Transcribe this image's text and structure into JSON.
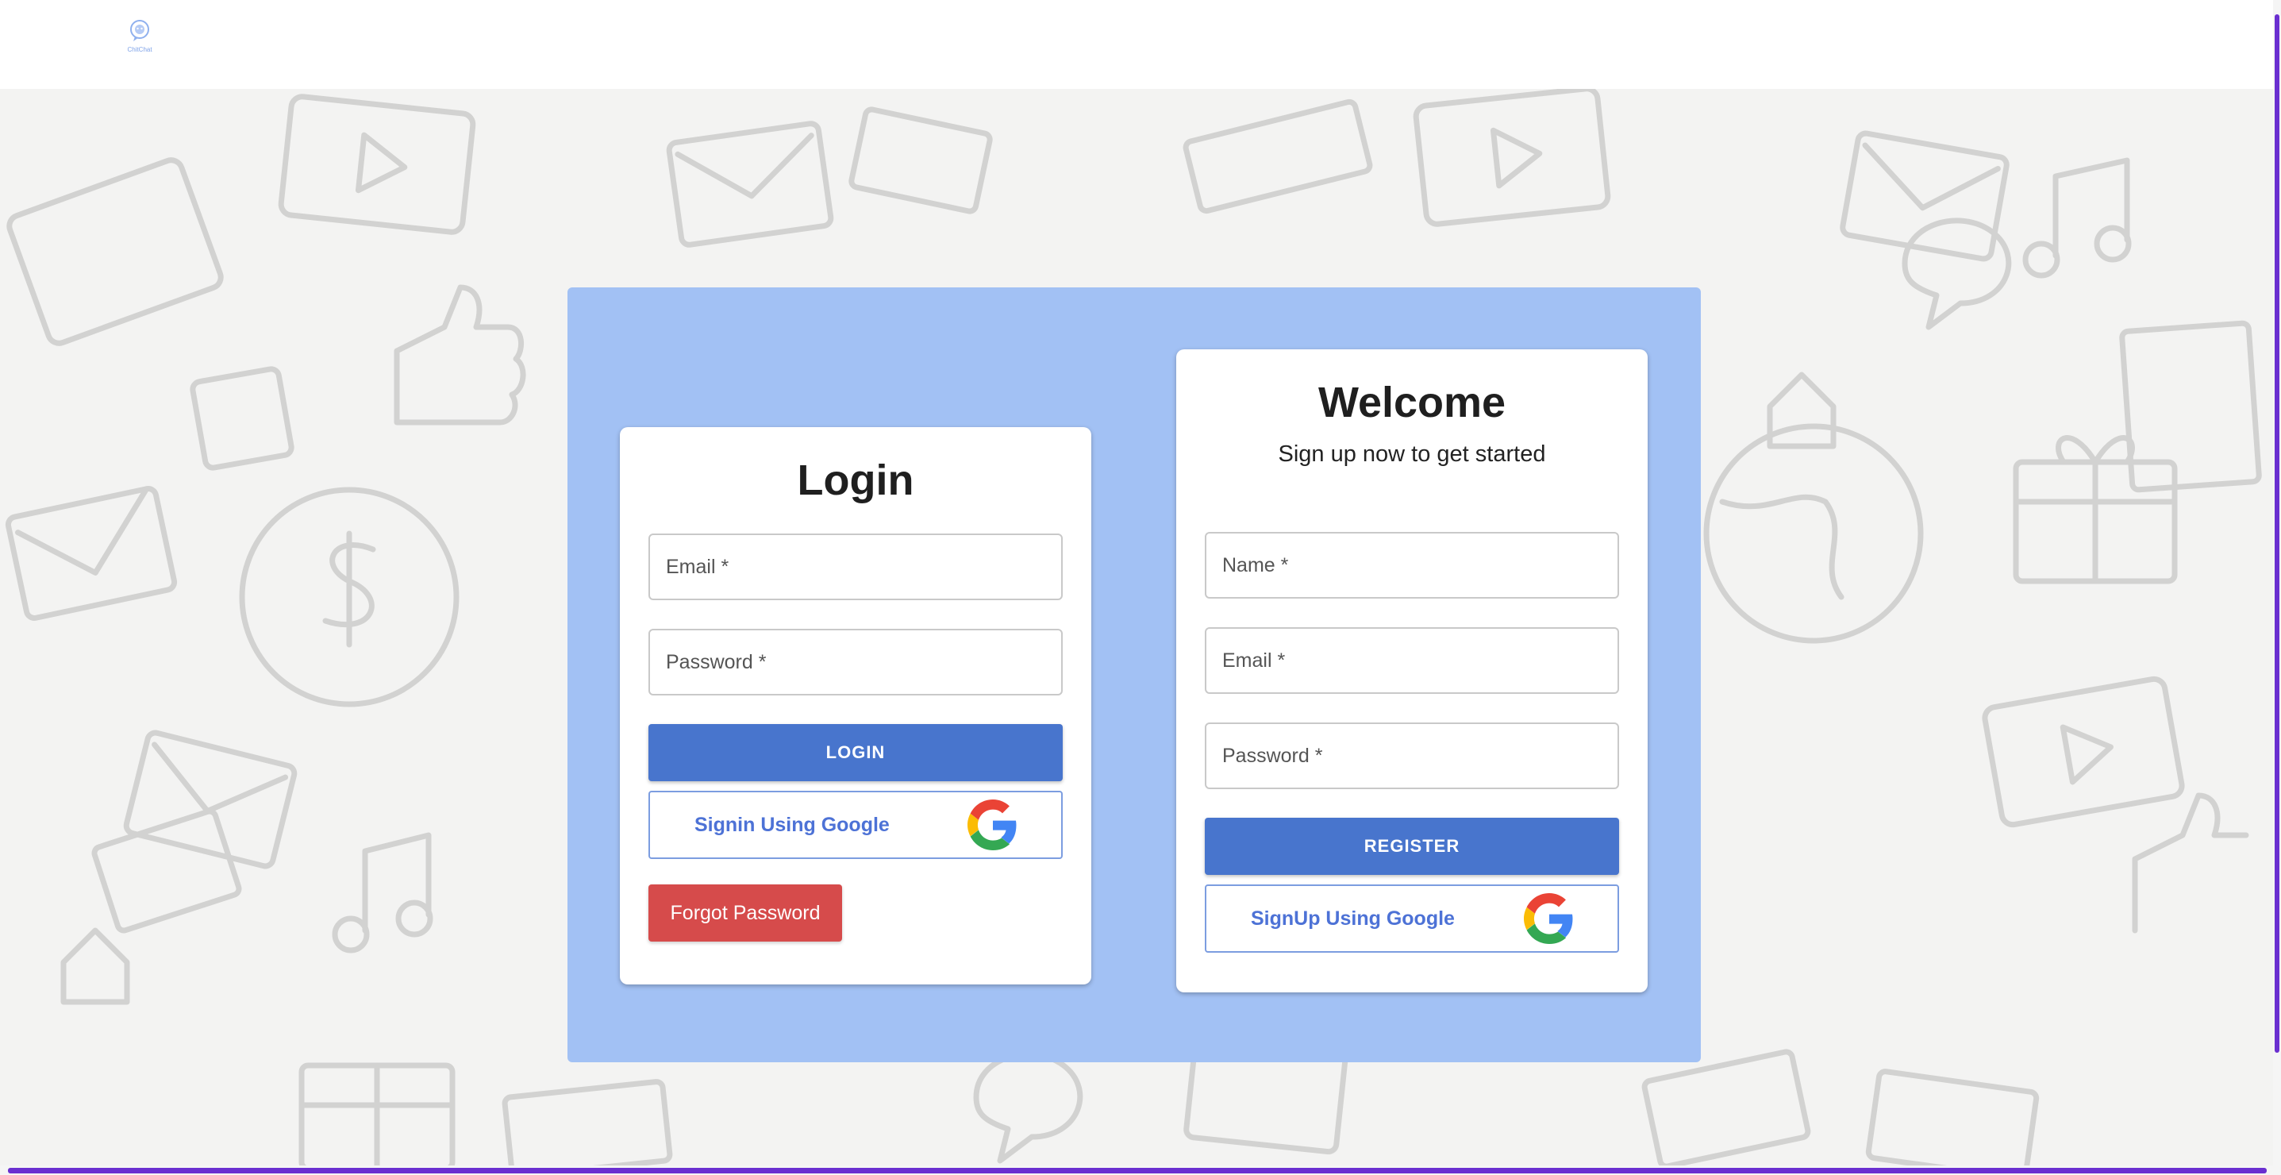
{
  "brand": {
    "logo_text": "ChitChat"
  },
  "login": {
    "title": "Login",
    "email_placeholder": "Email *",
    "password_placeholder": "Password *",
    "login_button": "LOGIN",
    "google_button": "Signin Using Google",
    "forgot_button": "Forgot Password"
  },
  "register": {
    "title": "Welcome",
    "subtitle": "Sign up now to get started",
    "name_placeholder": "Name *",
    "email_placeholder": "Email *",
    "password_placeholder": "Password *",
    "register_button": "REGISTER",
    "google_button": "SignUp Using Google"
  },
  "colors": {
    "panel": "#a2c1f4",
    "primary_button": "#4875cd",
    "google_text": "#4d72d6",
    "danger_button": "#d64b4b",
    "scrollbar": "#6a2fd0"
  },
  "icons": {
    "logo": "chat-bubble-logo-icon",
    "google": "google-g-icon"
  }
}
